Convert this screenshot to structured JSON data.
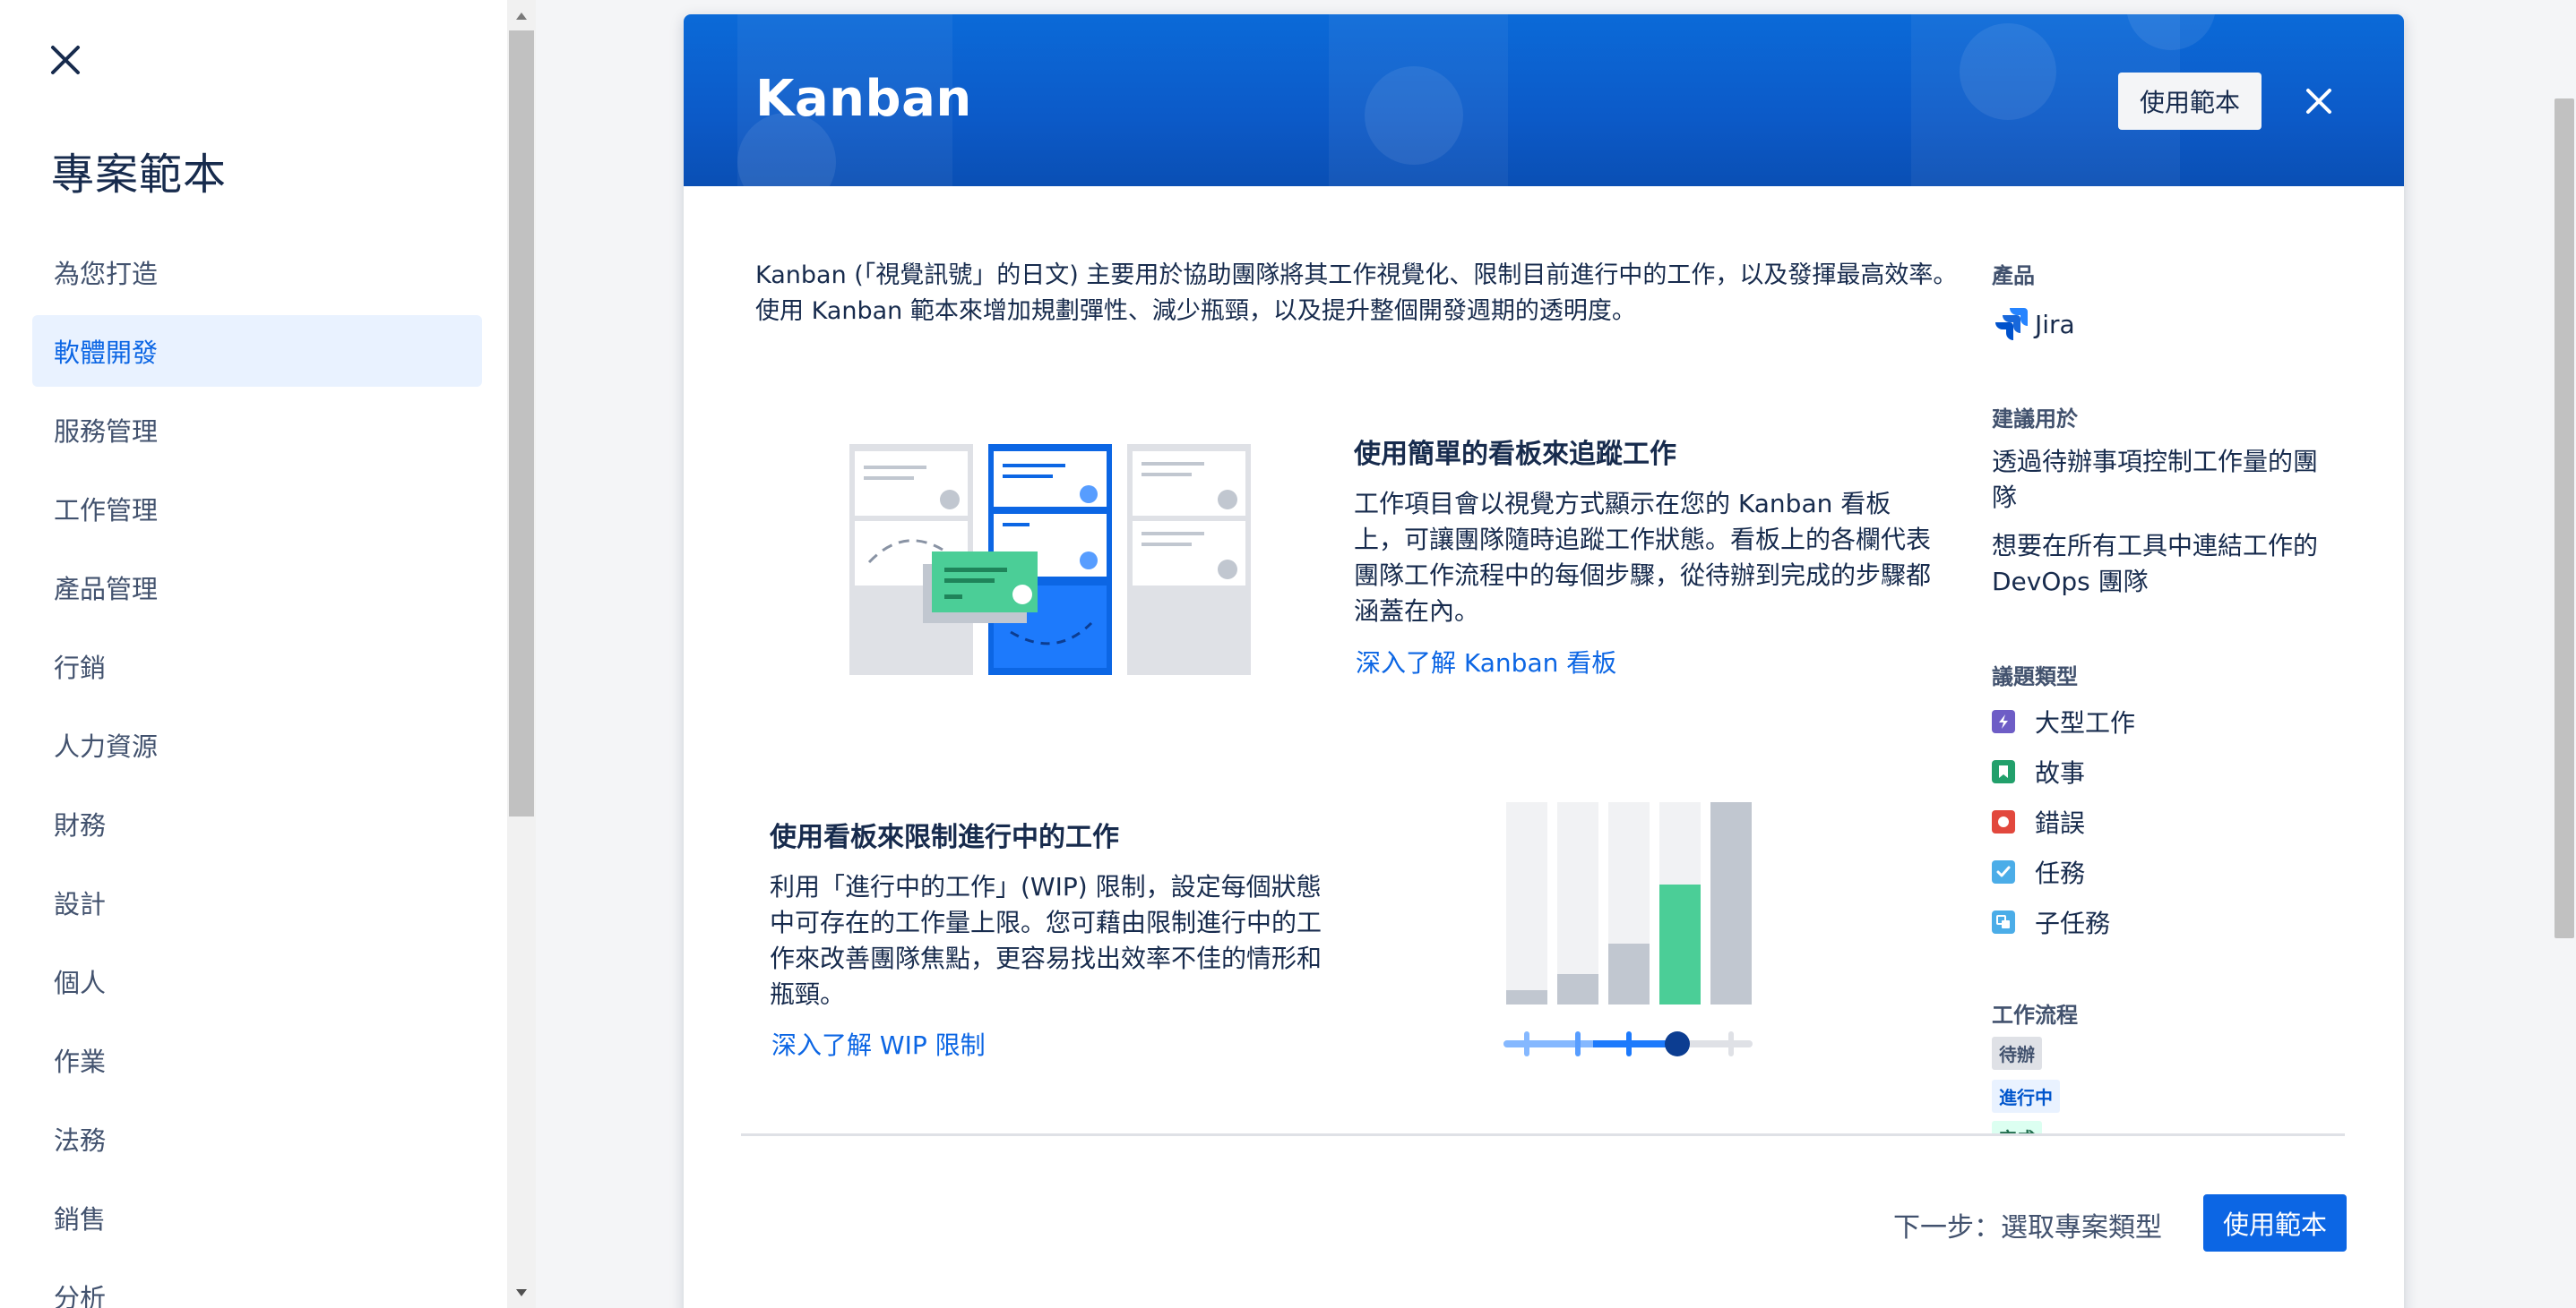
{
  "sidebar": {
    "title": "專案範本",
    "items": [
      {
        "label": "為您打造",
        "active": false
      },
      {
        "label": "軟體開發",
        "active": true
      },
      {
        "label": "服務管理",
        "active": false
      },
      {
        "label": "工作管理",
        "active": false
      },
      {
        "label": "產品管理",
        "active": false
      },
      {
        "label": "行銷",
        "active": false
      },
      {
        "label": "人力資源",
        "active": false
      },
      {
        "label": "財務",
        "active": false
      },
      {
        "label": "設計",
        "active": false
      },
      {
        "label": "個人",
        "active": false
      },
      {
        "label": "作業",
        "active": false
      },
      {
        "label": "法務",
        "active": false
      },
      {
        "label": "銷售",
        "active": false
      },
      {
        "label": "分析",
        "active": false
      }
    ]
  },
  "modal": {
    "title": "Kanban",
    "use_template_label": "使用範本",
    "intro": "Kanban (「視覺訊號」的日文) 主要用於協助團隊將其工作視覺化、限制目前進行中的工作，以及發揮最高效率。使用 Kanban 範本來增加規劃彈性、減少瓶頸，以及提升整個開發週期的透明度。",
    "section1": {
      "title": "使用簡單的看板來追蹤工作",
      "text": "工作項目會以視覺方式顯示在您的 Kanban 看板上，可讓團隊隨時追蹤工作狀態。看板上的各欄代表團隊工作流程中的每個步驟，從待辦到完成的步驟都涵蓋在內。",
      "link": "深入了解 Kanban 看板"
    },
    "section2": {
      "title": "使用看板來限制進行中的工作",
      "text": "利用「進行中的工作」(WIP) 限制，設定每個狀態中可存在的工作量上限。您可藉由限制進行中的工作來改善團隊焦點，更容易找出效率不佳的情形和瓶頸。",
      "link": "深入了解 WIP 限制"
    },
    "side": {
      "product_label": "產品",
      "product_name": "Jira",
      "recommended_label": "建議用於",
      "recommended": [
        "透過待辦事項控制工作量的團隊",
        "想要在所有工具中連結工作的 DevOps 團隊"
      ],
      "issue_types_label": "議題類型",
      "issue_types": [
        {
          "label": "大型工作",
          "icon": "epic-icon",
          "color": "#6e5dc6"
        },
        {
          "label": "故事",
          "icon": "story-icon",
          "color": "#22a06b"
        },
        {
          "label": "錯誤",
          "icon": "bug-icon",
          "color": "#e2483d"
        },
        {
          "label": "任務",
          "icon": "task-icon",
          "color": "#4bade8"
        },
        {
          "label": "子任務",
          "icon": "subtask-icon",
          "color": "#4bade8"
        }
      ],
      "workflow_label": "工作流程",
      "workflow": [
        {
          "label": "待辦",
          "color": "#42526e",
          "bg": "#dfe1e6"
        },
        {
          "label": "進行中",
          "color": "#0055cc",
          "bg": "#e9f2ff"
        },
        {
          "label": "完成",
          "color": "#216e4e",
          "bg": "#dcfff1"
        }
      ]
    },
    "footer": {
      "next_label": "下一步：選取專案類型",
      "use_template_label": "使用範本"
    }
  }
}
